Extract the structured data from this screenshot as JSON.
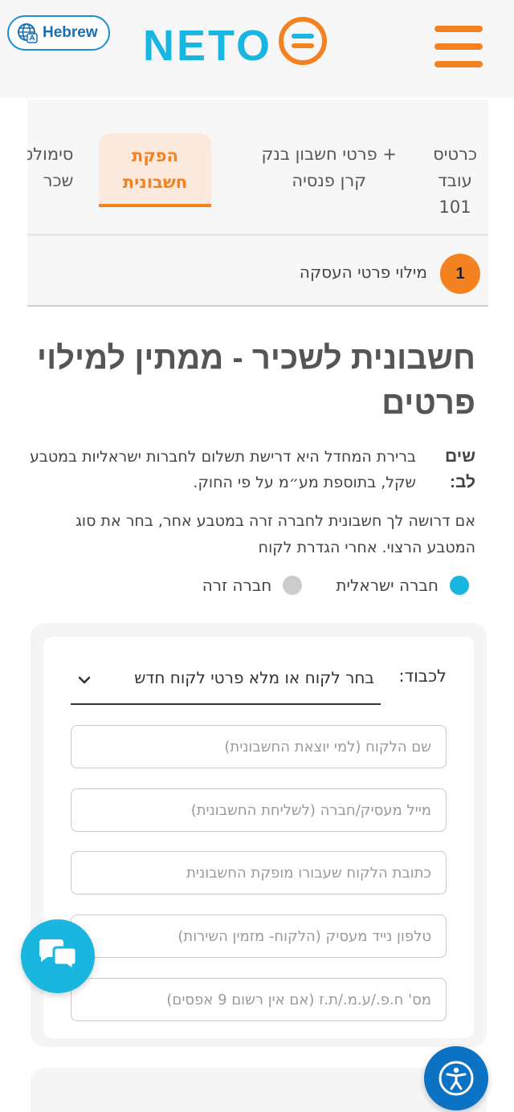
{
  "header": {
    "language_label": "Hebrew",
    "logo_text": "NETO",
    "accent_color": "#f58220",
    "brand_color": "#19b6e0"
  },
  "tabs": [
    {
      "label_line1": "כרטיס",
      "label_line2": "עובד",
      "label_line3": "101"
    },
    {
      "label_line1": "פרטי חשבון בנק +",
      "label_line2": "קרן פנסיה"
    },
    {
      "label_line1": "הפקת",
      "label_line2": "חשבונית",
      "active": true
    },
    {
      "label_line1": "סימולטור",
      "label_line2": "שכר"
    }
  ],
  "step": {
    "number": "1",
    "label": "מילוי פרטי העסקה"
  },
  "main": {
    "title": "חשבונית לשכיר - ממתין למילוי פרטים",
    "note_label": "שים לב:",
    "note_text": "ברירת המחדל היא דרישת תשלום לחברות ישראליות במטבע שקל, בתוספת מע״מ על פי החוק.",
    "info_text": "אם דרושה לך חשבונית לחברה זרה במטבע אחר, בחר את סוג המטבע הרצוי. אחרי הגדרת לקוח",
    "radio_israeli": "חברה ישראלית",
    "radio_foreign": "חברה זרה"
  },
  "form": {
    "to_label": "לכבוד:",
    "client_select": "בחר לקוח או מלא פרטי לקוח חדש",
    "client_name_placeholder": "שם הלקוח (למי יוצאת החשבונית)",
    "email_placeholder": "מייל מעסיק/חברה (לשליחת החשבונית)",
    "address_placeholder": "כתובת הלקוח שעבורו מופקת החשבונית",
    "phone_placeholder": "טלפון נייד מעסיק (הלקוח- מזמין השירות)",
    "company_id_placeholder": "מס' ח.פ./ע.מ./ת.ז (אם אין רשום 9 אפסים)"
  },
  "floating": {
    "chat_icon": "chat-bubbles-icon",
    "accessibility_icon": "accessibility-icon"
  }
}
